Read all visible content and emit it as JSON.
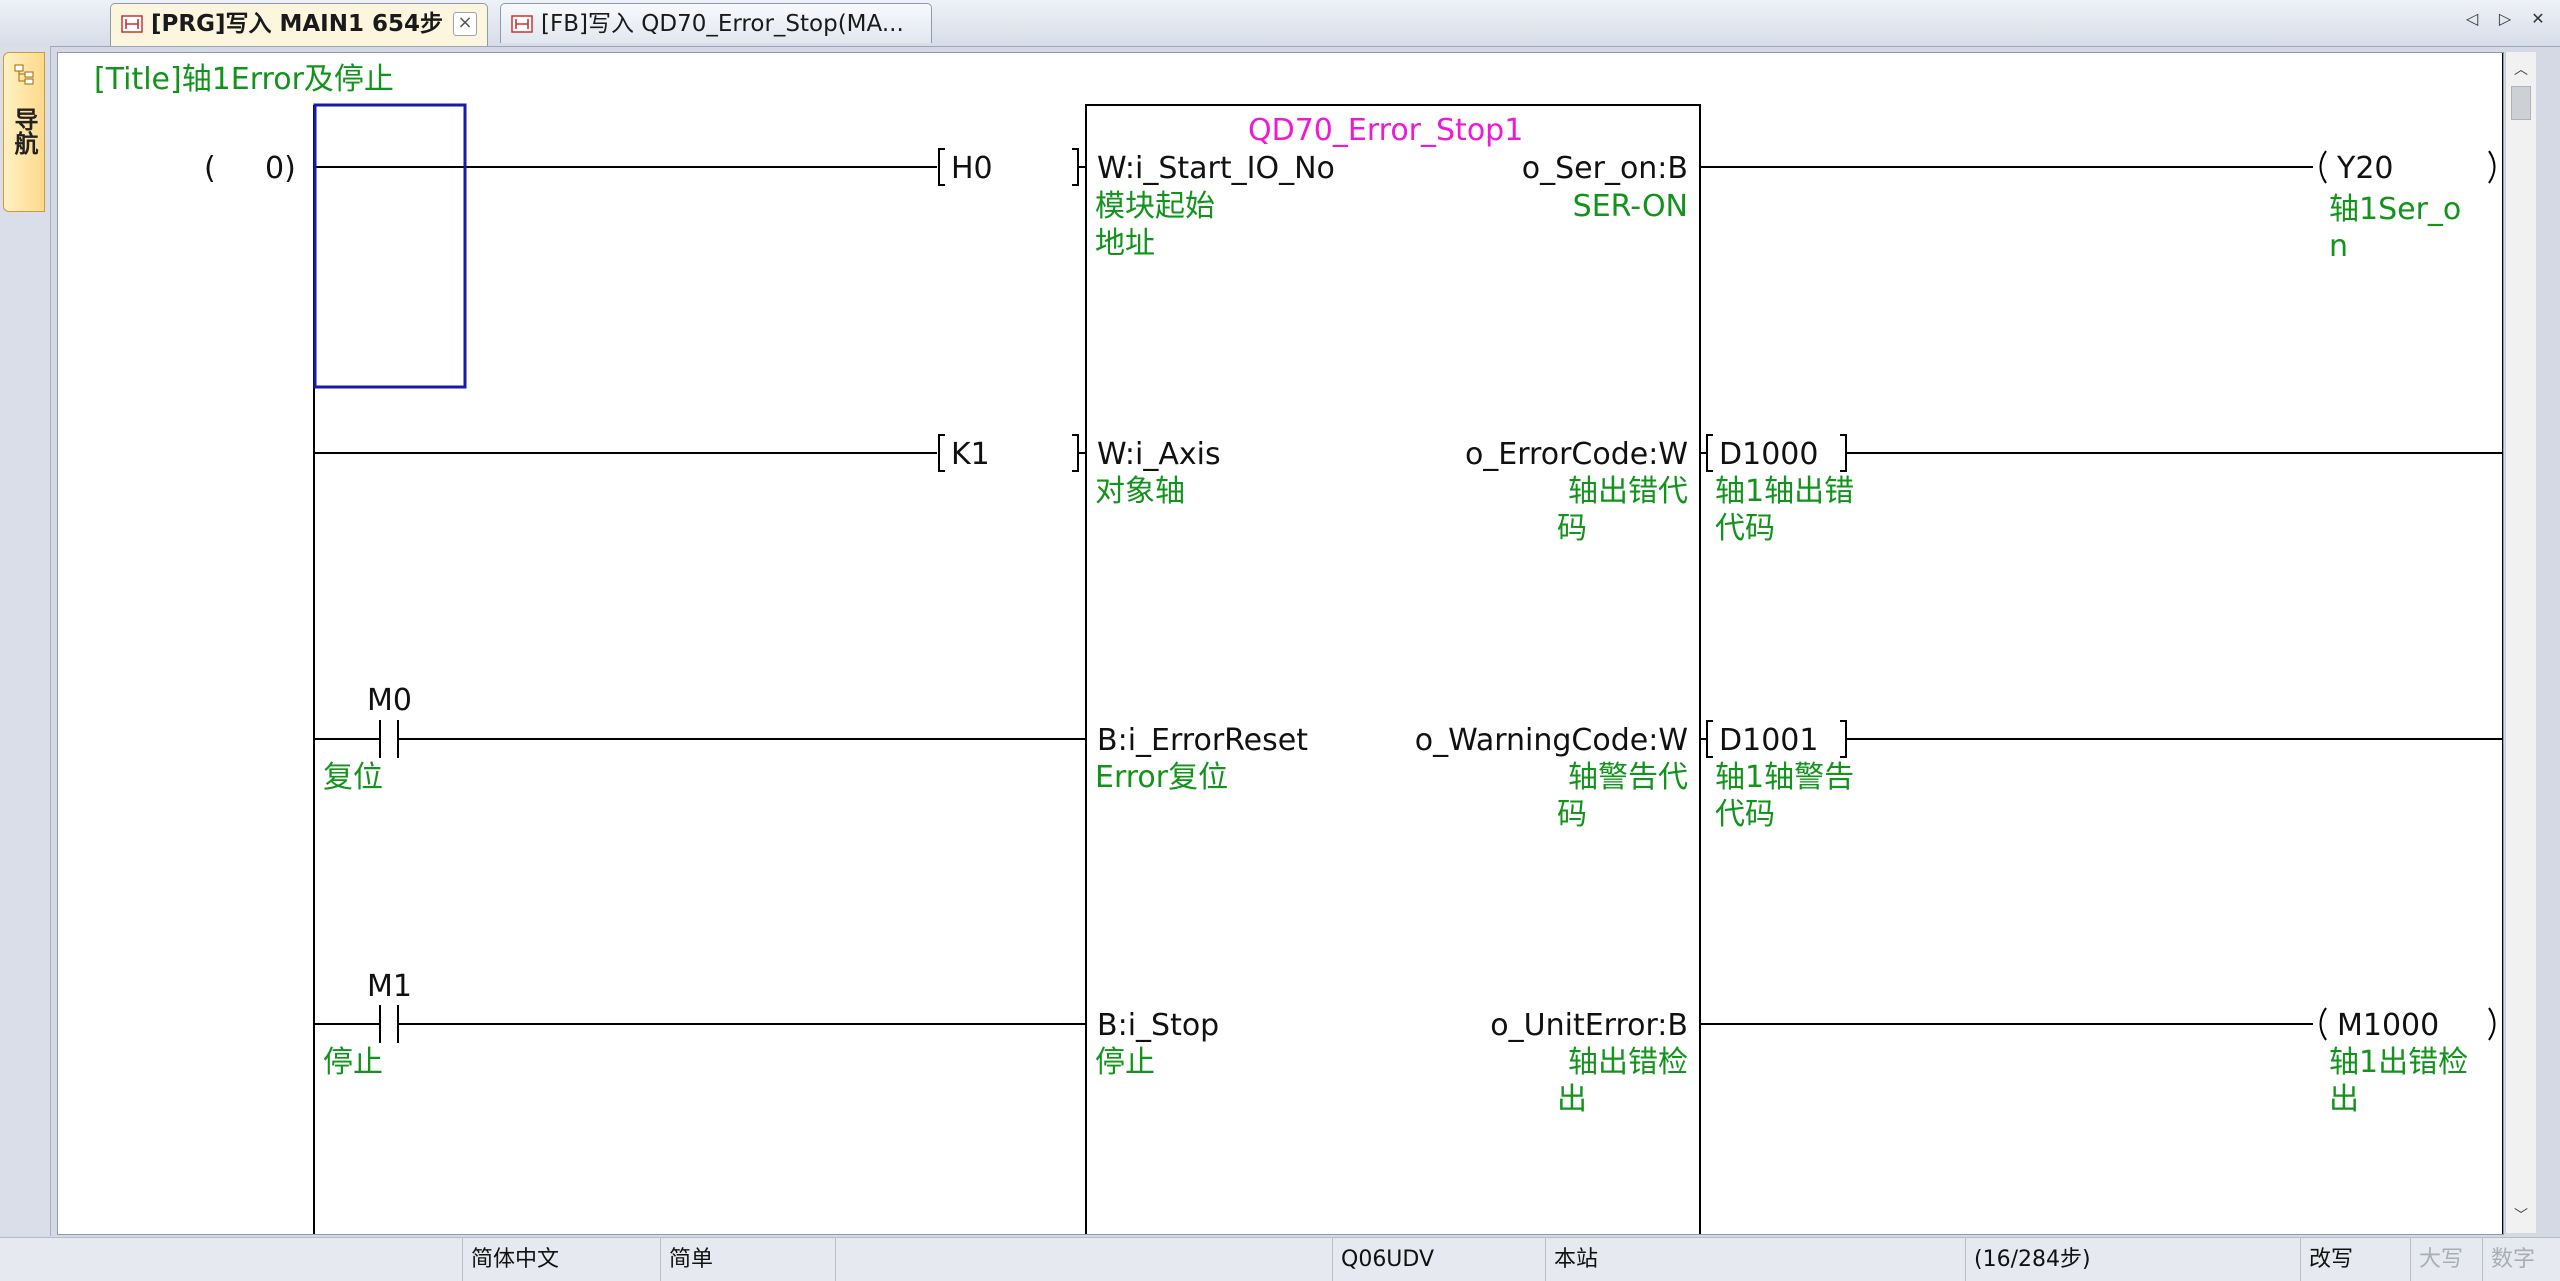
{
  "tabs": [
    {
      "label": "[PRG]写入 MAIN1 654步",
      "active": true,
      "close": "×"
    },
    {
      "label": "[FB]写入 QD70_Error_Stop(MA...",
      "active": false
    }
  ],
  "tab_nav": {
    "prev": "◁",
    "next": "▷"
  },
  "side_panel": {
    "label": "导航"
  },
  "ladder": {
    "title_comment": "[Title]轴1Error及停止",
    "step": {
      "open": "(",
      "number": "0)"
    },
    "fb_instance": "QD70_Error_Stop1",
    "inputs": [
      {
        "operand": "H0",
        "pin": "W:i_Start_IO_No",
        "pin_comment": [
          "模块起始",
          "地址"
        ]
      },
      {
        "operand": "K1",
        "pin": "W:i_Axis",
        "pin_comment": [
          "对象轴"
        ]
      },
      {
        "contact": "M0",
        "contact_comment": "复位",
        "pin": "B:i_ErrorReset",
        "pin_comment": [
          "Error复位"
        ]
      },
      {
        "contact": "M1",
        "contact_comment": "停止",
        "pin": "B:i_Stop",
        "pin_comment": [
          "停止"
        ]
      }
    ],
    "outputs": [
      {
        "pin": "o_Ser_on:B",
        "pin_comment": [
          "SER-ON"
        ],
        "operand": "Y20",
        "kind": "coil",
        "operand_comment": [
          "轴1Ser_o",
          "n"
        ]
      },
      {
        "pin": "o_ErrorCode:W",
        "pin_comment": [
          "轴出错代",
          "码"
        ],
        "operand": "D1000",
        "kind": "word",
        "operand_comment": [
          "轴1轴出错",
          "代码"
        ]
      },
      {
        "pin": "o_WarningCode:W",
        "pin_comment": [
          "轴警告代",
          "码"
        ],
        "operand": "D1001",
        "kind": "word",
        "operand_comment": [
          "轴1轴警告",
          "代码"
        ]
      },
      {
        "pin": "o_UnitError:B",
        "pin_comment": [
          "轴出错检",
          "出"
        ],
        "operand": "M1000",
        "kind": "coil",
        "operand_comment": [
          "轴1出错检",
          "出"
        ]
      }
    ]
  },
  "statusbar": {
    "language": "简体中文",
    "mode": "简单",
    "cpu": "Q06UDV",
    "station": "本站",
    "steps": "(16/284步)",
    "overwrite": "改写",
    "caps": "大写",
    "num": "数字"
  },
  "colors": {
    "comment": "#12931c",
    "instance": "#ee18d8",
    "cursor": "#1a1aa8",
    "wire": "#000000"
  }
}
